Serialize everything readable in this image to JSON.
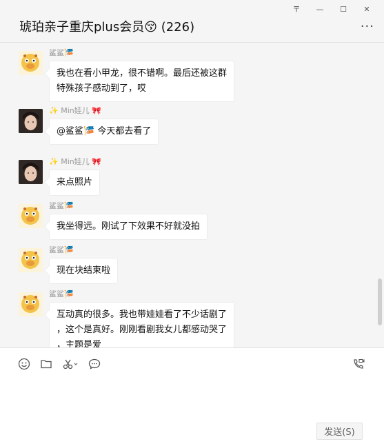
{
  "window": {
    "pin_glyph": "〒",
    "minimize_glyph": "—",
    "maximize_glyph": "☐",
    "close_glyph": "✕"
  },
  "header": {
    "title": "琥珀亲子重庆plus会员😚 (226)",
    "more_glyph": "···"
  },
  "messages": [
    {
      "sender": "鲨鲨",
      "sender_deco": "🎏",
      "avatar": "giraffe",
      "lines": [
        "我也在看小甲龙，很不错啊。最后还被这群",
        "特殊孩子感动到了，哎"
      ]
    },
    {
      "sender_prefix": "✨",
      "sender": "Min娃儿",
      "sender_deco": "🎀",
      "avatar": "person",
      "lines": [
        "@鲨鲨🎏  今天都去看了"
      ]
    },
    {
      "sender_prefix": "✨",
      "sender": "Min娃儿",
      "sender_deco": "🎀",
      "avatar": "person",
      "lines": [
        "来点照片"
      ]
    },
    {
      "sender": "鲨鲨",
      "sender_deco": "🎏",
      "avatar": "giraffe",
      "lines": [
        "我坐得远。刚试了下效果不好就没拍"
      ]
    },
    {
      "sender": "鲨鲨",
      "sender_deco": "🎏",
      "avatar": "giraffe",
      "lines": [
        "现在块结束啦"
      ]
    },
    {
      "sender": "鲨鲨",
      "sender_deco": "🎏",
      "avatar": "giraffe",
      "lines": [
        "互动真的很多。我也带娃娃看了不少话剧了",
        "，这个是真好。刚刚看剧我女儿都感动哭了",
        "，主题是爱"
      ]
    }
  ],
  "toolbar": {
    "icons": [
      "emoji-icon",
      "folder-icon",
      "scissors-icon",
      "chat-bubble-icon"
    ],
    "right_icon": "video-call-icon"
  },
  "composer": {
    "send_label": "发送(S)"
  }
}
